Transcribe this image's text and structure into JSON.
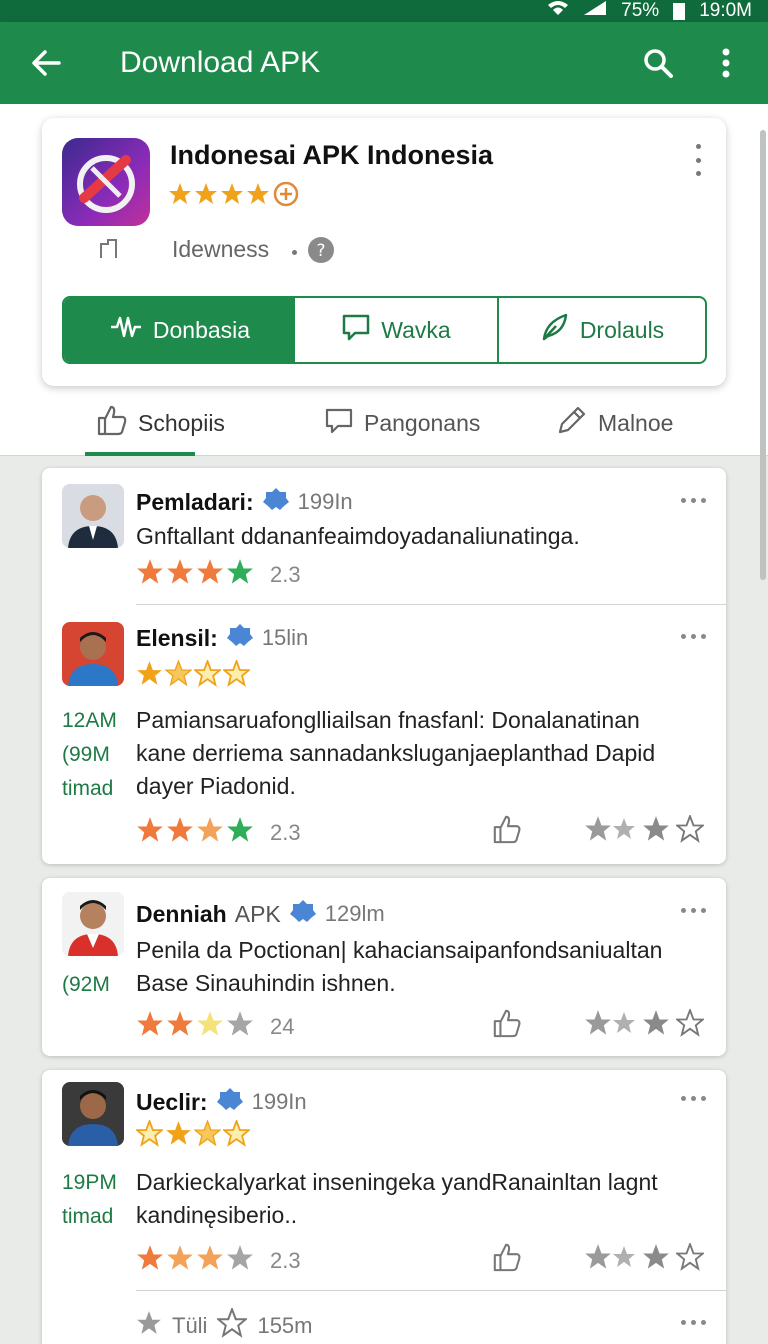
{
  "status": {
    "battery": "75%",
    "time": "19:0M"
  },
  "appbar": {
    "title": "Download APK",
    "back_icon": "arrow-left-icon",
    "search_icon": "search-icon",
    "more_icon": "more-vert-icon"
  },
  "app": {
    "name": "Indonesai APK Indonesia",
    "rating_stars": 4,
    "developer": "Idewness",
    "buttons": [
      {
        "label": "Donbasia"
      },
      {
        "label": "Wavka"
      },
      {
        "label": "Drolauls"
      }
    ]
  },
  "tabs": [
    {
      "label": "Schopiis"
    },
    {
      "label": "Pangonans"
    },
    {
      "label": "Malnoe"
    }
  ],
  "reviews": [
    {
      "name": "Pemladari:",
      "time": "199In",
      "text": "Gnftallant ddananfeaimdoyadanaliunatinga.",
      "stars": [
        "orange",
        "orange",
        "orange",
        "green"
      ],
      "score": "2.3"
    },
    {
      "name": "Elensil:",
      "time": "15lin",
      "stars_top": [
        "gold",
        "gold-half",
        "gold-outline",
        "gold-outline"
      ],
      "side": [
        "12AM",
        "(99M",
        "timad"
      ],
      "text_lines": [
        "Pamiansaruafonglliailsan fnasfanl: Donalanatinan",
        "kane derriema sannadanksluganjaeplanthad Dapid",
        "dayer Piadonid."
      ],
      "stars": [
        "orange",
        "orange",
        "orange-light",
        "green"
      ],
      "score": "2.3"
    },
    {
      "name": "Denniah",
      "extra": "APK",
      "time": "129lm",
      "side": [
        "(92M"
      ],
      "text_lines": [
        "Penila da Poctionan| kahaciansaipanfondsaniualtan",
        "Base Sinauhindin ishnen."
      ],
      "stars": [
        "orange",
        "orange",
        "yellow-light",
        "grey"
      ],
      "score": "24"
    },
    {
      "name": "Ueclir:",
      "time": "199In",
      "stars_top": [
        "gold-outline",
        "gold",
        "gold-half",
        "gold-outline"
      ],
      "side": [
        "19PM",
        "timad"
      ],
      "text_lines": [
        "Darkieckalyarkat inseningeka yandRanainltan lagnt",
        "kandinęsiberio.."
      ],
      "stars": [
        "orange",
        "orange-light",
        "orange-light",
        "grey"
      ],
      "score": "2.3",
      "footer": {
        "label": "Tüli",
        "time": "155m"
      }
    }
  ]
}
